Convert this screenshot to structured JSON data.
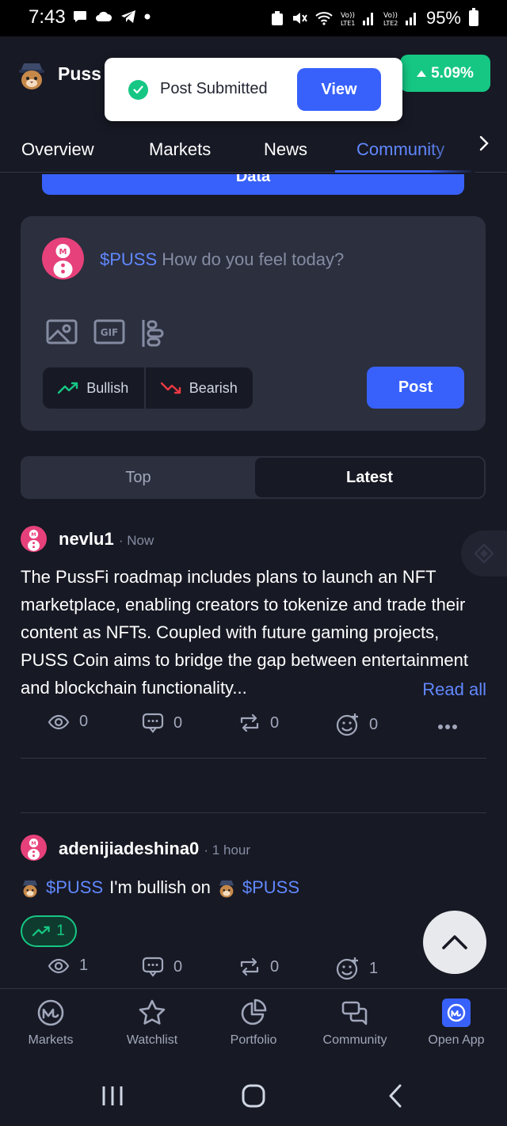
{
  "status_bar": {
    "time": "7:43",
    "battery": "95%"
  },
  "header": {
    "coin_name": "Puss",
    "price_change": "5.09%",
    "colors": {
      "up": "#16c784",
      "accent": "#3861fb"
    }
  },
  "toast": {
    "message": "Post Submitted",
    "action": "View"
  },
  "tabs": {
    "overview": "Overview",
    "markets": "Markets",
    "news": "News",
    "community": "Community",
    "active": "Community"
  },
  "data_button": {
    "label": "Data"
  },
  "composer": {
    "ticker": "$PUSS",
    "placeholder": "How do you feel today?",
    "media_icons": [
      "image-icon",
      "gif-icon",
      "poll-icon"
    ],
    "gif_label": "GIF",
    "bullish": "Bullish",
    "bearish": "Bearish",
    "post": "Post"
  },
  "feed_tabs": {
    "top": "Top",
    "latest": "Latest",
    "active": "Latest"
  },
  "posts": [
    {
      "author": "nevlu1",
      "time": "· Now",
      "body": "The PussFi roadmap includes plans to launch an NFT marketplace, enabling creators to tokenize and trade their content as NFTs. Coupled with future gaming projects, PUSS Coin aims to bridge the gap between entertainment and blockchain functionality...",
      "read_all": "Read all",
      "views": "0",
      "comments": "0",
      "reposts": "0",
      "reactions": "0"
    },
    {
      "author": "adenijiadeshina0",
      "time": "· 1 hour",
      "tag1": "$PUSS",
      "middle": "I'm bullish on",
      "tag2": "$PUSS",
      "bullish_count": "1",
      "views": "1",
      "comments": "0",
      "reposts": "0",
      "reactions": "1"
    }
  ],
  "bottom_nav": [
    "Markets",
    "Watchlist",
    "Portfolio",
    "Community",
    "Open App"
  ]
}
